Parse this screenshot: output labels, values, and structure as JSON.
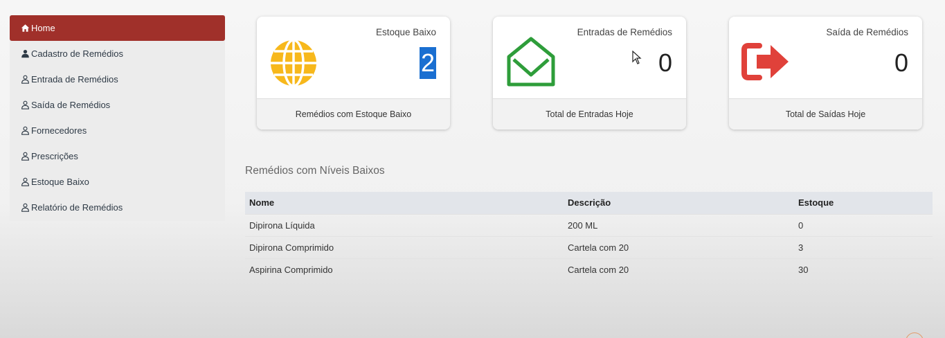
{
  "sidebar": {
    "items": [
      {
        "label": "Home",
        "icon": "home-icon",
        "active": true
      },
      {
        "label": "Cadastro de Remédios",
        "icon": "user-filled-icon"
      },
      {
        "label": "Entrada de Remédios",
        "icon": "user-icon"
      },
      {
        "label": "Saída de Remédios",
        "icon": "user-icon"
      },
      {
        "label": "Fornecedores",
        "icon": "user-icon"
      },
      {
        "label": "Prescrições",
        "icon": "user-icon"
      },
      {
        "label": "Estoque Baixo",
        "icon": "user-icon"
      },
      {
        "label": "Relatório de Remédios",
        "icon": "user-icon"
      }
    ]
  },
  "cards": [
    {
      "title": "Estoque Baixo",
      "value": "2",
      "footer": "Remédios com Estoque Baixo",
      "icon": "globe-icon",
      "color": "#f7b81c"
    },
    {
      "title": "Entradas de Remédios",
      "value": "0",
      "footer": "Total de Entradas Hoje",
      "icon": "envelope-open-icon",
      "color": "#2e9d3a"
    },
    {
      "title": "Saída de Remédios",
      "value": "0",
      "footer": "Total de Saídas Hoje",
      "icon": "sign-out-icon",
      "color": "#e0413a"
    }
  ],
  "section": {
    "title": "Remédios com Níveis Baixos"
  },
  "table": {
    "headers": [
      "Nome",
      "Descrição",
      "Estoque"
    ],
    "rows": [
      [
        "Dipirona Líquida",
        "200 ML",
        "0"
      ],
      [
        "Dipirona Comprimido",
        "Cartela com 20",
        "3"
      ],
      [
        "Aspirina Comprimido",
        "Cartela com 20",
        "30"
      ]
    ]
  },
  "colors": {
    "active_nav": "#a0302a",
    "table_header": "#e2e5ea"
  }
}
